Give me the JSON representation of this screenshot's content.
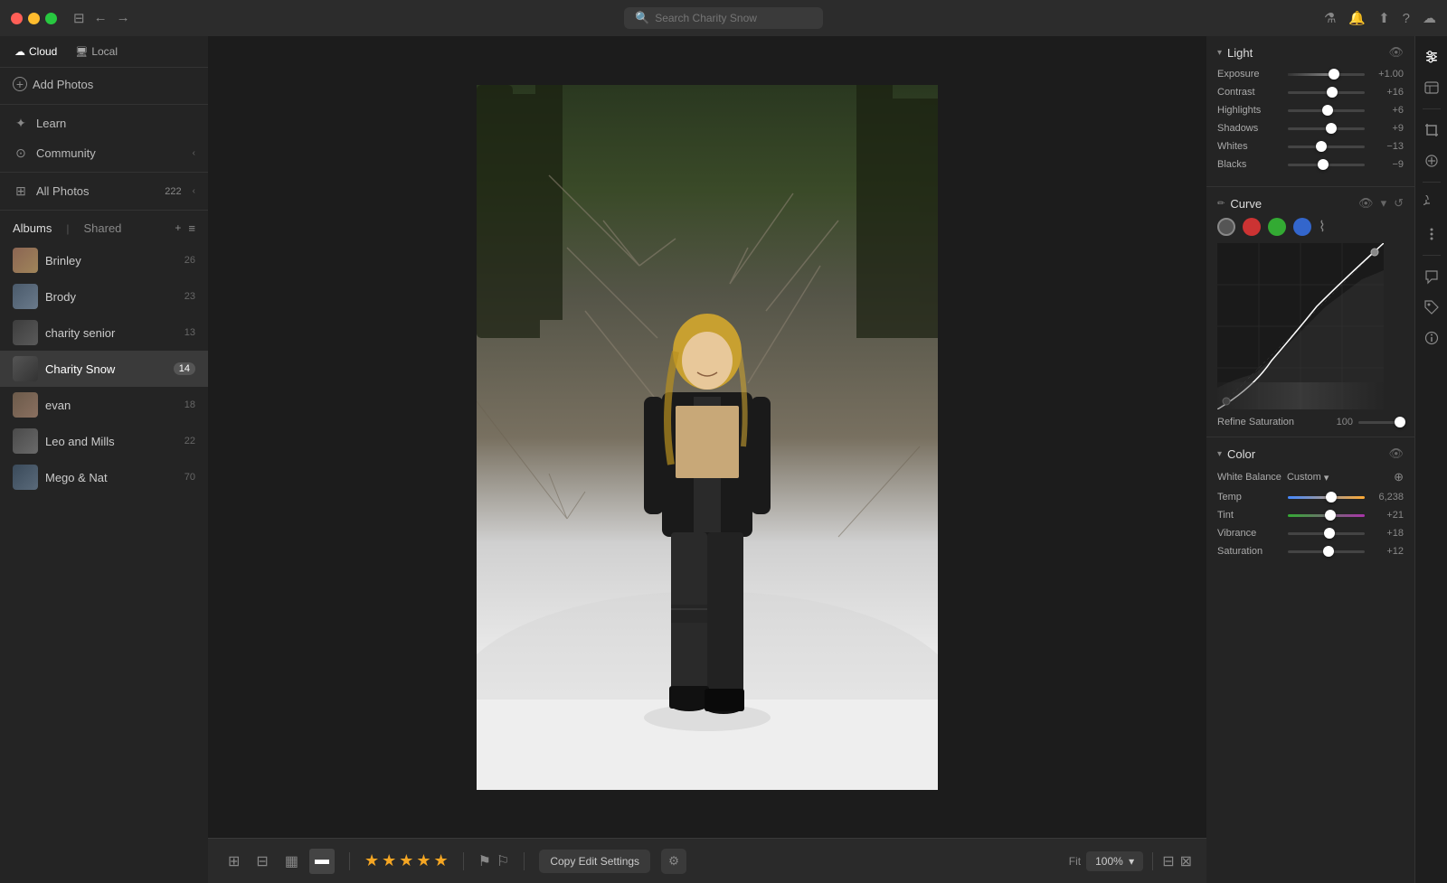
{
  "titlebar": {
    "search_placeholder": "Search Charity Snow",
    "tabs": [
      {
        "label": "Cloud",
        "icon": "☁",
        "active": true
      },
      {
        "label": "Local",
        "icon": "🖥",
        "active": false
      }
    ]
  },
  "sidebar": {
    "add_photos_label": "Add Photos",
    "cloud_label": "Cloud",
    "local_label": "Local",
    "nav_items": [
      {
        "label": "Learn",
        "icon": "★",
        "id": "learn"
      },
      {
        "label": "Community",
        "icon": "⊙",
        "id": "community",
        "has_chevron": true
      },
      {
        "label": "All Photos",
        "id": "all-photos",
        "count": "222",
        "has_chevron": true
      }
    ],
    "albums_tab": "Albums",
    "shared_tab": "Shared",
    "albums": [
      {
        "name": "Brinley",
        "count": "26",
        "thumb": "brinley"
      },
      {
        "name": "Brody",
        "count": "23",
        "thumb": "brody"
      },
      {
        "name": "charity senior",
        "count": "13",
        "thumb": "charity-senior"
      },
      {
        "name": "Charity Snow",
        "count": "14",
        "thumb": "charity-snow",
        "active": true
      },
      {
        "name": "evan",
        "count": "18",
        "thumb": "evan"
      },
      {
        "name": "Leo and Mills",
        "count": "22",
        "thumb": "leo"
      },
      {
        "name": "Mego & Nat",
        "count": "70",
        "thumb": "mego"
      }
    ]
  },
  "toolbar": {
    "copy_edit_label": "Copy Edit Settings",
    "fit_label": "Fit",
    "zoom_label": "100%",
    "stars": [
      "★",
      "★",
      "★",
      "★",
      "★"
    ],
    "star_count": 5
  },
  "right_panel": {
    "light_section": {
      "title": "Light",
      "sliders": [
        {
          "label": "Exposure",
          "value": "+1.00",
          "position": 0.6
        },
        {
          "label": "Contrast",
          "value": "+16",
          "position": 0.58
        },
        {
          "label": "Highlights",
          "value": "+6",
          "position": 0.52
        },
        {
          "label": "Shadows",
          "value": "+9",
          "position": 0.56
        },
        {
          "label": "Whites",
          "value": "−13",
          "position": 0.44
        },
        {
          "label": "Blacks",
          "value": "−9",
          "position": 0.46
        }
      ]
    },
    "curve_section": {
      "title": "Curve",
      "refine_saturation_label": "Refine Saturation",
      "refine_saturation_value": "100"
    },
    "color_section": {
      "title": "Color",
      "white_balance_label": "White Balance",
      "white_balance_value": "Custom",
      "sliders": [
        {
          "label": "Temp",
          "value": "6,238",
          "position": 0.56
        },
        {
          "label": "Tint",
          "value": "+21",
          "position": 0.55
        },
        {
          "label": "Vibrance",
          "value": "+18",
          "position": 0.54
        },
        {
          "label": "Saturation",
          "value": "+12",
          "position": 0.53
        }
      ]
    }
  },
  "icons": {
    "search": "🔍",
    "filter": "⚗",
    "bell": "🔔",
    "share": "⬆",
    "help": "?",
    "cloud_sync": "☁"
  }
}
